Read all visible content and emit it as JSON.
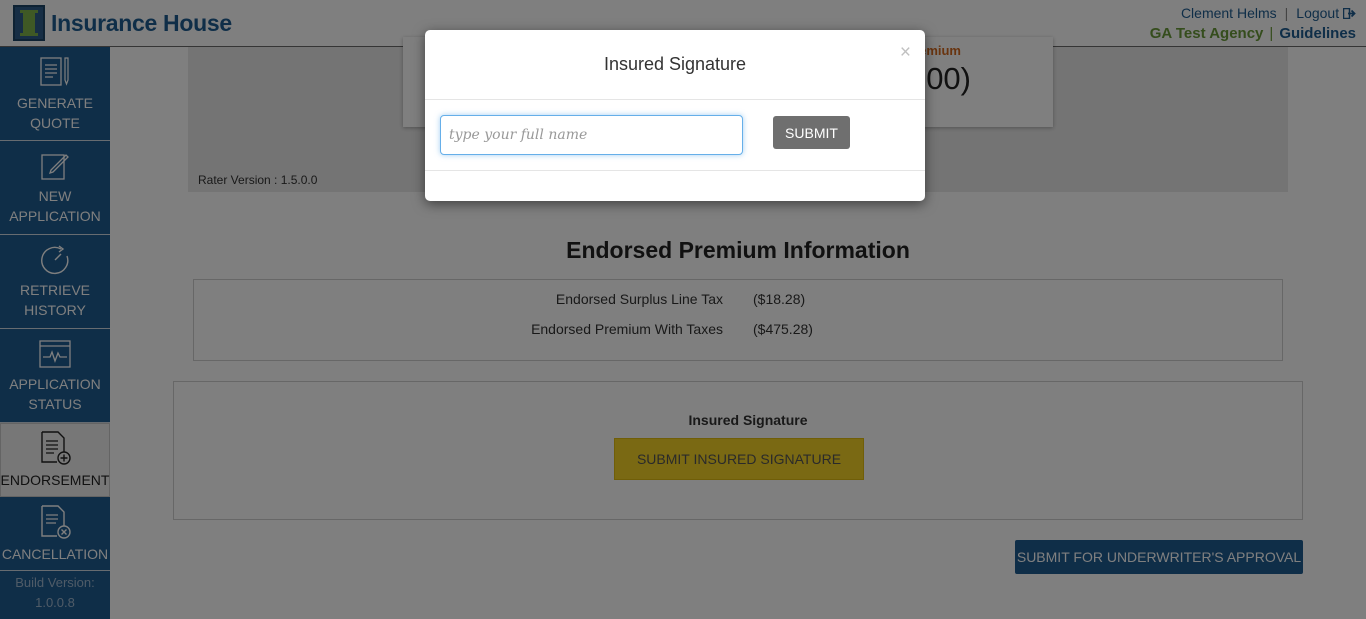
{
  "header": {
    "brand": "Insurance House",
    "user_name": "Clement Helms",
    "separator": "|",
    "logout_label": "Logout",
    "agency": "GA Test Agency",
    "guidelines_label": "Guidelines"
  },
  "sidebar": {
    "items": [
      {
        "line1": "GENERATE",
        "line2": "QUOTE",
        "icon": "document-pencil-icon"
      },
      {
        "line1": "NEW",
        "line2": "APPLICATION",
        "icon": "edit-icon"
      },
      {
        "line1": "RETRIEVE",
        "line2": "HISTORY",
        "icon": "history-icon"
      },
      {
        "line1": "APPLICATION",
        "line2": "STATUS",
        "icon": "status-pulse-icon"
      },
      {
        "line1": "ENDORSEMENT",
        "line2": "",
        "icon": "document-add-icon",
        "active": true
      },
      {
        "line1": "CANCELLATION",
        "line2": "",
        "icon": "document-cancel-icon"
      }
    ],
    "build_label": "Build Version:",
    "build_version": "1.0.0.8"
  },
  "main": {
    "premium_label": "emium",
    "premium_value": "00)",
    "rater_version": "Rater Version : 1.5.0.0",
    "section_title": "Endorsed Premium Information",
    "premium_rows": [
      {
        "label": "Endorsed Surplus Line Tax",
        "value": "($18.28)"
      },
      {
        "label": "Endorsed Premium With Taxes",
        "value": "($475.28)"
      }
    ],
    "signature_label": "Insured Signature",
    "submit_signature_label": "SUBMIT INSURED SIGNATURE",
    "underwriter_button": "SUBMIT FOR UNDERWRITER'S APPROVAL"
  },
  "modal": {
    "title": "Insured Signature",
    "close_symbol": "×",
    "input_placeholder": "type your full name",
    "input_value": "",
    "submit_label": "SUBMIT"
  },
  "colors": {
    "brand_blue": "#1f5d91",
    "agency_green": "#6a9a3a",
    "signature_yellow": "#f5d327",
    "premium_orange": "#d2691e"
  }
}
